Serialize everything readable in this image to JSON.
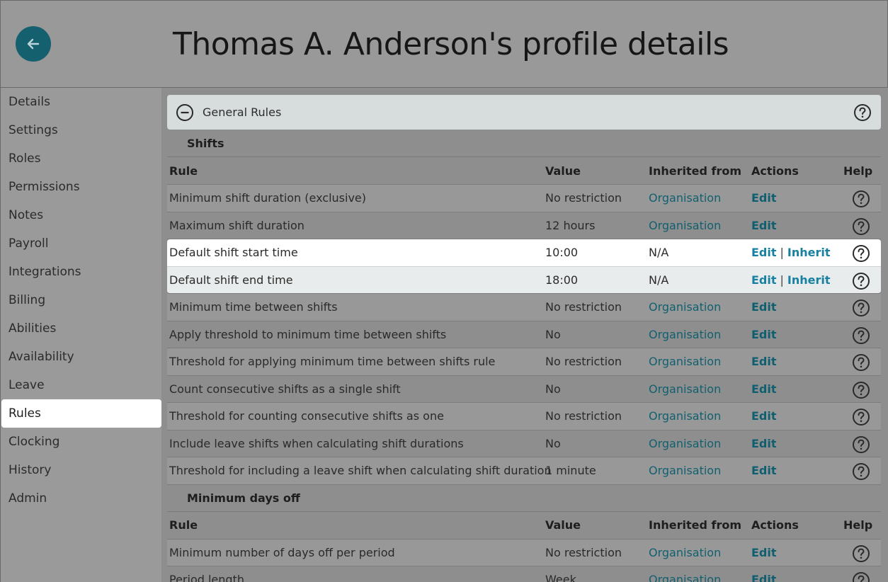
{
  "header": {
    "title": "Thomas A. Anderson's profile details"
  },
  "sidebar": {
    "items": [
      {
        "label": "Details"
      },
      {
        "label": "Settings"
      },
      {
        "label": "Roles"
      },
      {
        "label": "Permissions"
      },
      {
        "label": "Notes"
      },
      {
        "label": "Payroll"
      },
      {
        "label": "Integrations"
      },
      {
        "label": "Billing"
      },
      {
        "label": "Abilities"
      },
      {
        "label": "Availability"
      },
      {
        "label": "Leave"
      },
      {
        "label": "Rules"
      },
      {
        "label": "Clocking"
      },
      {
        "label": "History"
      },
      {
        "label": "Admin"
      }
    ],
    "active": "Rules"
  },
  "panel": {
    "title": "General Rules"
  },
  "columns": {
    "rule": "Rule",
    "value": "Value",
    "inherited": "Inherited from",
    "actions": "Actions",
    "help": "Help"
  },
  "sections": [
    {
      "title": "Shifts",
      "rows": [
        {
          "rule": "Minimum shift duration (exclusive)",
          "value": "No restriction",
          "inherited": "Organisation",
          "edit": "Edit"
        },
        {
          "rule": "Maximum shift duration",
          "value": "12 hours",
          "inherited": "Organisation",
          "edit": "Edit"
        },
        {
          "rule": "Default shift start time",
          "value": "10:00",
          "inherited": "N/A",
          "edit": "Edit",
          "inherit": "Inherit"
        },
        {
          "rule": "Default shift end time",
          "value": "18:00",
          "inherited": "N/A",
          "edit": "Edit",
          "inherit": "Inherit"
        },
        {
          "rule": "Minimum time between shifts",
          "value": "No restriction",
          "inherited": "Organisation",
          "edit": "Edit"
        },
        {
          "rule": "Apply threshold to minimum time between shifts",
          "value": "No",
          "inherited": "Organisation",
          "edit": "Edit"
        },
        {
          "rule": "Threshold for applying minimum time between shifts rule",
          "value": "No restriction",
          "inherited": "Organisation",
          "edit": "Edit"
        },
        {
          "rule": "Count consecutive shifts as a single shift",
          "value": "No",
          "inherited": "Organisation",
          "edit": "Edit"
        },
        {
          "rule": "Threshold for counting consecutive shifts as one",
          "value": "No restriction",
          "inherited": "Organisation",
          "edit": "Edit"
        },
        {
          "rule": "Include leave shifts when calculating shift durations",
          "value": "No",
          "inherited": "Organisation",
          "edit": "Edit"
        },
        {
          "rule": "Threshold for including a leave shift when calculating shift duration",
          "value": "1 minute",
          "inherited": "Organisation",
          "edit": "Edit"
        }
      ]
    },
    {
      "title": "Minimum days off",
      "rows": [
        {
          "rule": "Minimum number of days off per period",
          "value": "No restriction",
          "inherited": "Organisation",
          "edit": "Edit"
        },
        {
          "rule": "Period length",
          "value": "Week",
          "inherited": "Organisation",
          "edit": "Edit"
        }
      ]
    }
  ]
}
